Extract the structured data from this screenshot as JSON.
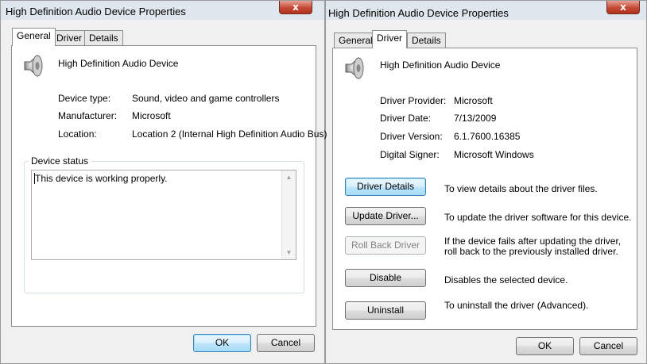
{
  "left": {
    "title": "High Definition Audio Device Properties",
    "close_glyph": "x",
    "tabs": [
      "General",
      "Driver",
      "Details"
    ],
    "device_name": "High Definition Audio Device",
    "fields": [
      {
        "label": "Device type:",
        "value": "Sound, video and game controllers"
      },
      {
        "label": "Manufacturer:",
        "value": "Microsoft"
      },
      {
        "label": "Location:",
        "value": "Location 2 (Internal High Definition Audio Bus)"
      }
    ],
    "status_legend": "Device status",
    "status_text": "This device is working properly.",
    "ok": "OK",
    "cancel": "Cancel"
  },
  "right": {
    "title": "High Definition Audio Device Properties",
    "close_glyph": "x",
    "tabs": [
      "General",
      "Driver",
      "Details"
    ],
    "device_name": "High Definition Audio Device",
    "fields": [
      {
        "label": "Driver Provider:",
        "value": "Microsoft"
      },
      {
        "label": "Driver Date:",
        "value": "7/13/2009"
      },
      {
        "label": "Driver Version:",
        "value": "6.1.7600.16385"
      },
      {
        "label": "Digital Signer:",
        "value": "Microsoft Windows"
      }
    ],
    "actions": [
      {
        "button": "Driver Details",
        "desc": "To view details about the driver files."
      },
      {
        "button": "Update Driver...",
        "desc": "To update the driver software for this device."
      },
      {
        "button": "Roll Back Driver",
        "desc": "If the device fails after updating the driver, roll back to the previously installed driver.",
        "disabled": true
      },
      {
        "button": "Disable",
        "desc": "Disables the selected device."
      },
      {
        "button": "Uninstall",
        "desc": "To uninstall the driver (Advanced)."
      }
    ],
    "ok": "OK",
    "cancel": "Cancel"
  },
  "colors": {
    "titlebar": "#dfe6ee",
    "close_red": "#c44b36",
    "default_button": "#3c7fb1"
  },
  "icons": [
    "speaker-icon",
    "close-icon",
    "scroll-up-icon",
    "scroll-down-icon"
  ]
}
